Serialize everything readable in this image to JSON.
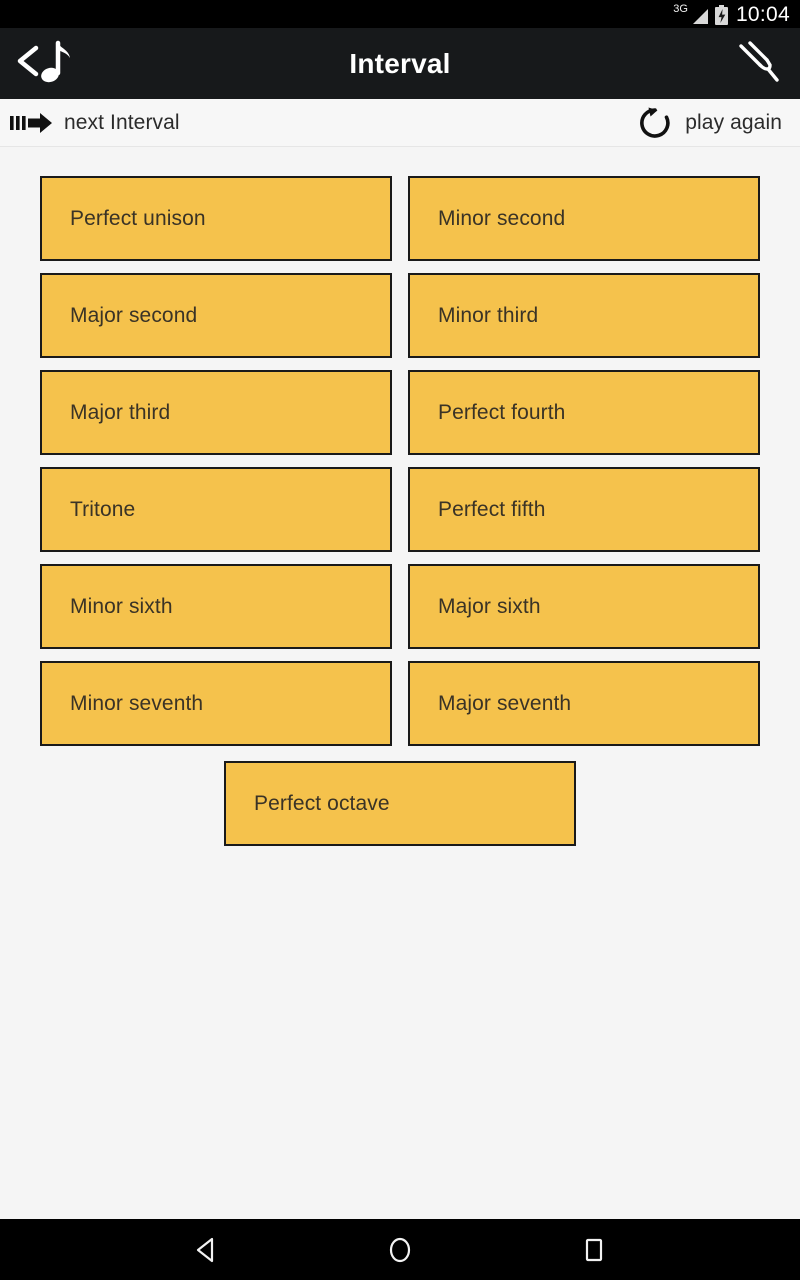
{
  "status_bar": {
    "network": "3G",
    "clock": "10:04",
    "signal_icon": "signal-bars-icon",
    "battery_icon": "battery-charging-icon"
  },
  "action_bar": {
    "title": "Interval",
    "logo_icon": "back-music-note-icon",
    "action_icon": "tuning-fork-icon"
  },
  "toolbar": {
    "next_label": "next Interval",
    "next_icon": "fast-forward-icon",
    "play_again_label": "play again",
    "play_again_icon": "refresh-icon"
  },
  "intervals": {
    "rows": [
      {
        "left": "Perfect unison",
        "right": "Minor second"
      },
      {
        "left": "Major second",
        "right": "Minor third"
      },
      {
        "left": "Major third",
        "right": "Perfect fourth"
      },
      {
        "left": "Tritone",
        "right": "Perfect fifth"
      },
      {
        "left": "Minor sixth",
        "right": "Major sixth"
      },
      {
        "left": "Minor seventh",
        "right": "Major seventh"
      }
    ],
    "last": "Perfect octave"
  },
  "nav_bar": {
    "back_icon": "back-triangle-icon",
    "home_icon": "home-circle-icon",
    "recents_icon": "recents-square-icon"
  },
  "colors": {
    "button_fill": "#f5c24c",
    "button_border": "#1a1a1a",
    "action_bar": "#17191b",
    "status_bar": "#000000",
    "content_bg": "#f5f5f5"
  }
}
